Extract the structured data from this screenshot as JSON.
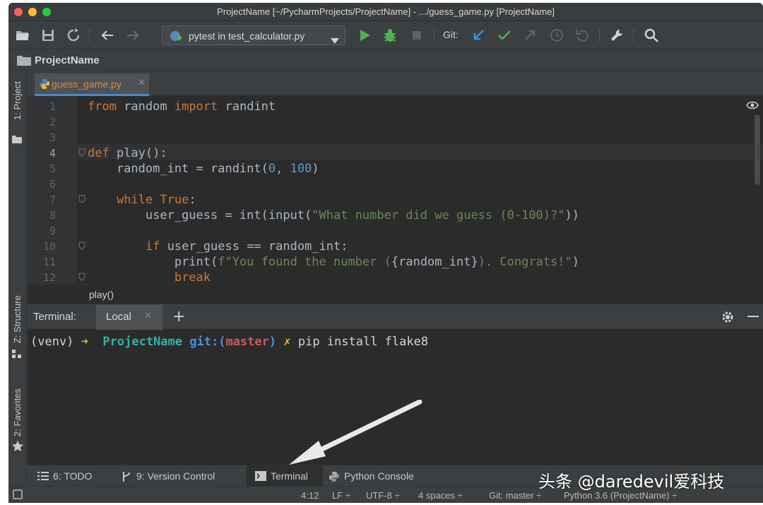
{
  "window": {
    "title": "ProjectName [~/PycharmProjects/ProjectName] - .../guess_game.py [ProjectName]"
  },
  "toolbar": {
    "run_config": "pytest in test_calculator.py",
    "git_label": "Git:"
  },
  "navbar": {
    "project": "ProjectName"
  },
  "left_strip": {
    "project_tab": "1: Project",
    "structure_tab": "Z: Structure",
    "favorites_tab": "2: Favorites"
  },
  "editor": {
    "tab_filename": "guess_game.py",
    "breadcrumb": "play()",
    "line_numbers": [
      "1",
      "2",
      "3",
      "4",
      "5",
      "6",
      "7",
      "8",
      "9",
      "10",
      "11",
      "12"
    ],
    "lines": [
      [
        {
          "t": "from",
          "c": "kw"
        },
        {
          "t": " random ",
          "c": ""
        },
        {
          "t": "import",
          "c": "kw"
        },
        {
          "t": " randint",
          "c": ""
        }
      ],
      [],
      [],
      [
        {
          "t": "def",
          "c": "kw"
        },
        {
          "t": " play():",
          "c": ""
        }
      ],
      [
        {
          "t": "    random_int = randint(",
          "c": ""
        },
        {
          "t": "0",
          "c": "num"
        },
        {
          "t": ", ",
          "c": ""
        },
        {
          "t": "100",
          "c": "num"
        },
        {
          "t": ")",
          "c": ""
        }
      ],
      [],
      [
        {
          "t": "    ",
          "c": ""
        },
        {
          "t": "while True",
          "c": "kw"
        },
        {
          "t": ":",
          "c": ""
        }
      ],
      [
        {
          "t": "        user_guess = int(input(",
          "c": ""
        },
        {
          "t": "\"What number did we guess (0-100)?\"",
          "c": "str"
        },
        {
          "t": "))",
          "c": ""
        }
      ],
      [],
      [
        {
          "t": "        ",
          "c": ""
        },
        {
          "t": "if",
          "c": "kw"
        },
        {
          "t": " user_guess == random_int:",
          "c": ""
        }
      ],
      [
        {
          "t": "            print(",
          "c": ""
        },
        {
          "t": "f\"You found the number (",
          "c": "str"
        },
        {
          "t": "{random_int}",
          "c": ""
        },
        {
          "t": "). Congrats!\"",
          "c": "str"
        },
        {
          "t": ")",
          "c": ""
        }
      ],
      [
        {
          "t": "            ",
          "c": ""
        },
        {
          "t": "break",
          "c": "kw"
        }
      ]
    ]
  },
  "terminal": {
    "label": "Terminal:",
    "tab": "Local",
    "add": "+",
    "prompt": {
      "venv": "(venv)",
      "arrow": "➜",
      "dir": "ProjectName",
      "git": "git:(",
      "branch": "master",
      "git_close": ")",
      "x": "✗",
      "command": "pip install flake8"
    }
  },
  "bottom_tabs": {
    "todo": "6: TODO",
    "version_control": "9: Version Control",
    "terminal": "Terminal",
    "python_console": "Python Console"
  },
  "statusbar": {
    "position": "4:12",
    "line_sep": "LF ÷",
    "encoding": "UTF-8 ÷",
    "indent": "4 spaces ÷",
    "git": "Git: master ÷",
    "interpreter": "Python 3.6 (ProjectName) ÷"
  },
  "watermark": "头条 @daredevil爱科技",
  "colors": {
    "keyword": "#cc7832",
    "string": "#6a8759",
    "number": "#6897bb",
    "editor_bg": "#2b2b2b",
    "panel_bg": "#3c3f41"
  }
}
